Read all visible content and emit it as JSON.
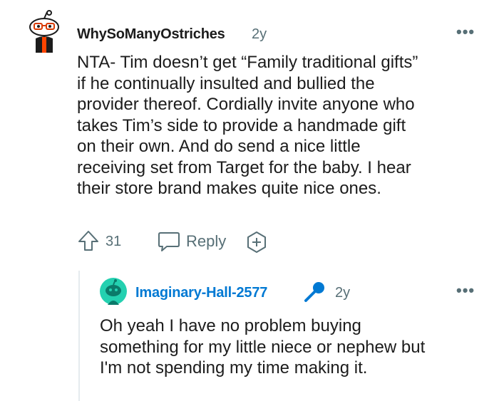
{
  "comment": {
    "username": "WhySoManyOstriches",
    "time": "2y",
    "more": "•••",
    "body": "NTA- Tim doesn’t get “Family traditional gifts”\nif he continually insulted and bullied the\nprovider thereof. Cordially invite anyone who\ntakes Tim’s side to provide a handmade gift\non their own. And do send a nice little\nreceiving set from Target for the baby. I hear\ntheir store brand makes quite nice ones.",
    "votes": "31",
    "reply_label": "Reply"
  },
  "reply": {
    "username": "Imaginary-Hall-2577",
    "time": "2y",
    "more": "•••",
    "body": "Oh yeah I have no problem buying\nsomething for my little niece or nephew but\nI'm not spending my time making it."
  },
  "colors": {
    "username_reply": "#0079d3",
    "meta": "#576f76",
    "text": "#1c1c1c",
    "thread_line": "#e5ebee"
  },
  "icons": {
    "avatar1": "snoo-avatar-icon",
    "avatar2": "snoo-avatar-icon",
    "upvote": "upvote-arrow-icon",
    "reply": "speech-bubble-icon",
    "award": "award-plus-icon",
    "mic": "microphone-icon"
  }
}
